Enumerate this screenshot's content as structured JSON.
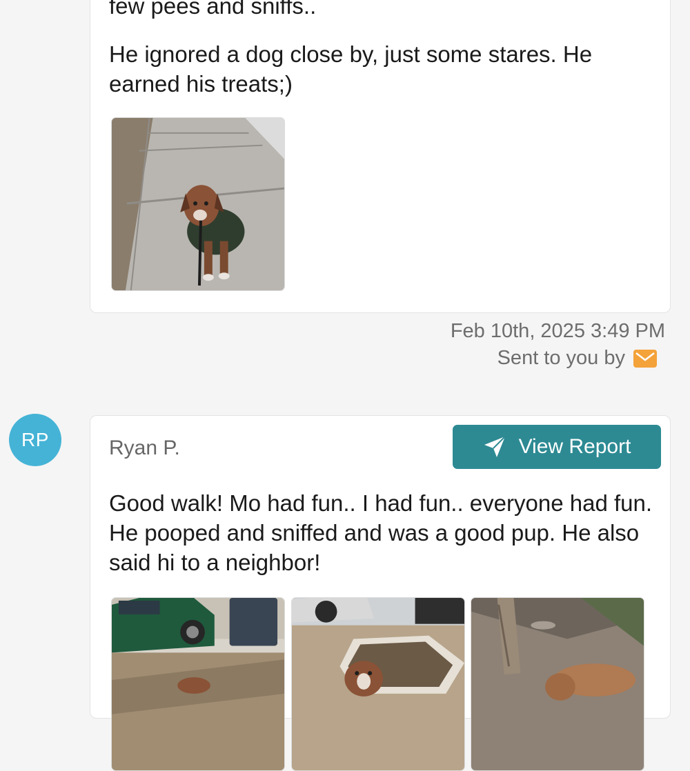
{
  "colors": {
    "accent": "#2d8a93",
    "avatar_bg": "#45b3d6",
    "mail_icon": "#f4a23a",
    "muted_text": "#6d6d6d"
  },
  "message1": {
    "text_top": "few pees and sniffs..",
    "text_body": "He ignored a dog close by, just some stares. He earned his treats;)",
    "photo_icon": "dog-photo",
    "timestamp": "Feb 10th, 2025 3:49 PM",
    "sent_by": "Sent to you by",
    "sent_icon": "envelope-icon"
  },
  "message2": {
    "avatar_initials": "RP",
    "sender_name": "Ryan P.",
    "button_label": "View Report",
    "button_icon": "paper-plane-icon",
    "text_body": "Good walk! Mo had fun.. I had fun.. everyone had fun. He pooped and sniffed and was a good pup. He also said hi to a neighbor!",
    "photo_icons": [
      "dog-photo",
      "dog-photo",
      "dog-photo"
    ]
  }
}
